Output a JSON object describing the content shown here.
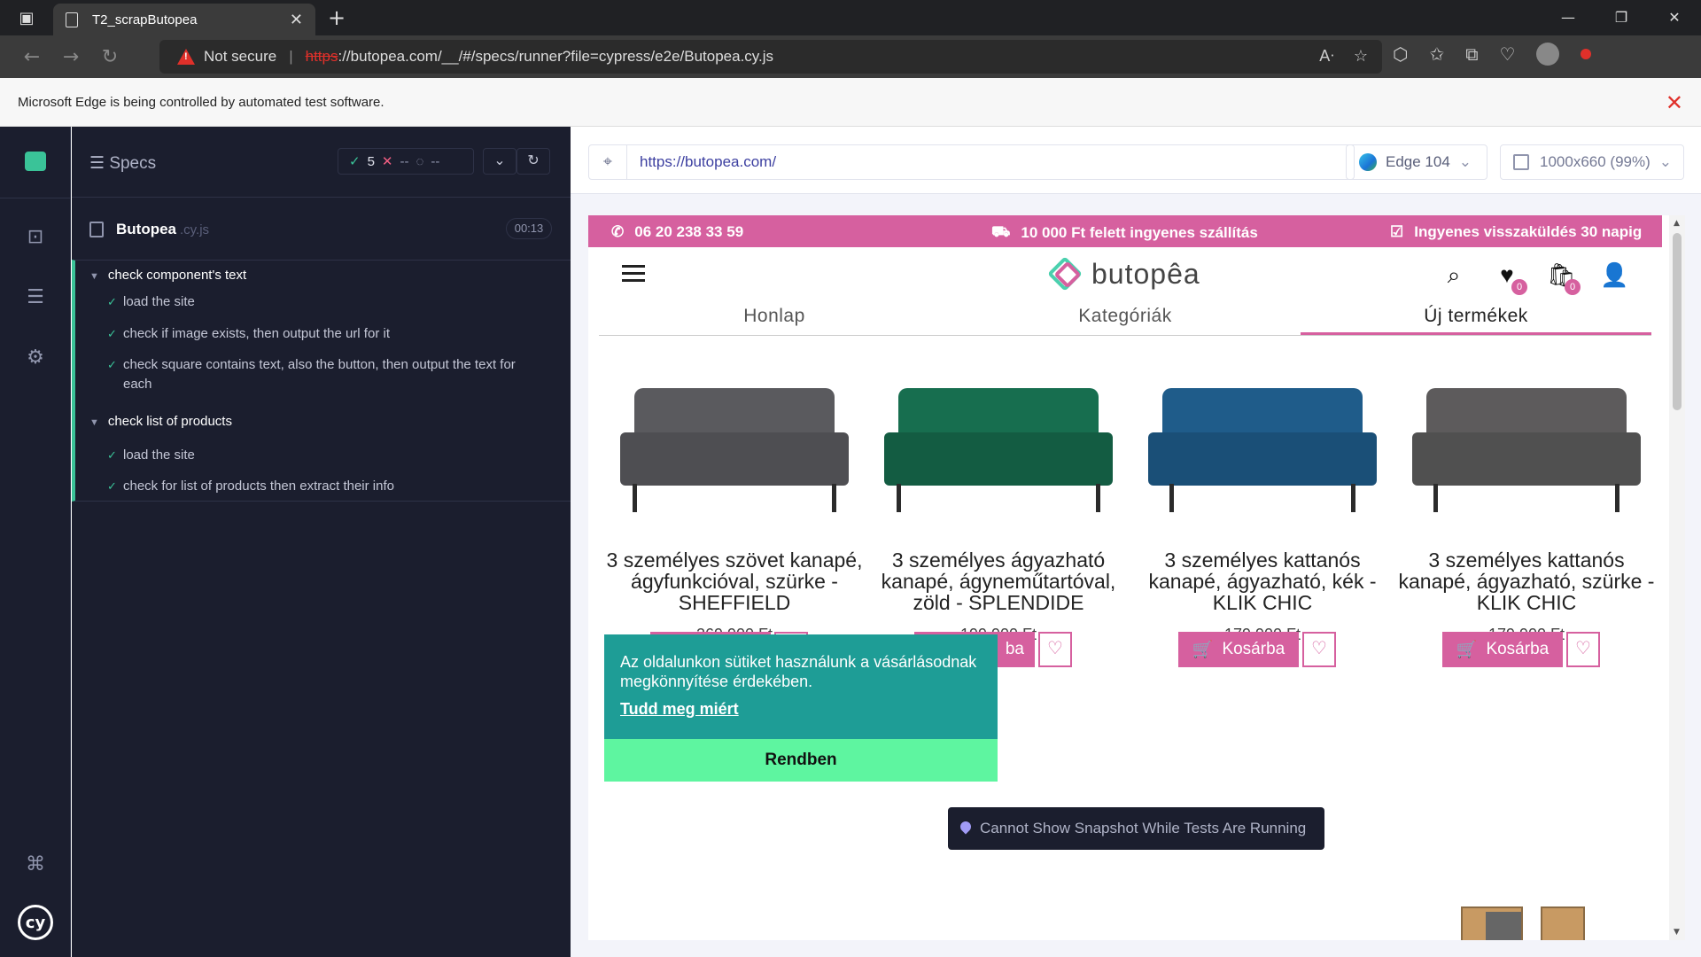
{
  "browser": {
    "tab_title": "T2_scrapButopea",
    "not_secure": "Not secure",
    "url_scheme": "https",
    "url_rest": "://butopea.com/__/#/specs/runner?file=cypress/e2e/Butopea.cy.js",
    "automation_notice": "Microsoft Edge is being controlled by automated test software."
  },
  "cypress": {
    "specs_label": "Specs",
    "passed_count": "5",
    "failed_count": "--",
    "pending_count": "--",
    "spec_name": "Butopea",
    "spec_ext": ".cy.js",
    "duration": "00:13",
    "suites": [
      {
        "title": "check component's text",
        "tests": [
          "load the site",
          "check if image exists, then output the url for it",
          "check square contains text, also the button, then output the text for each"
        ]
      },
      {
        "title": "check list of products",
        "tests": [
          "load the site",
          "check for list of products then extract their info"
        ]
      }
    ],
    "aut_url": "https://butopea.com/",
    "browser_label": "Edge 104",
    "viewport_label": "1000x660 (99%)",
    "snapshot_message": "Cannot Show Snapshot While Tests Are Running"
  },
  "site": {
    "colors": {
      "accent": "#d6609f",
      "teal": "#1e9d96",
      "green": "#5ef5a0"
    },
    "phone": "06 20 238 33 59",
    "shipping": "10 000 Ft felett ingyenes szállítás",
    "returns": "Ingyenes visszaküldés 30 napig",
    "brand": "butopêa",
    "wishlist_count": "0",
    "cart_count": "0",
    "nav": [
      "Honlap",
      "Kategóriák",
      "Új termékek"
    ],
    "products": [
      {
        "title": "3 személyes szövet kanapé, ágyfunkcióval, szürke - SHEFFIELD",
        "price": "269.900 Ft"
      },
      {
        "title": "3 személyes ágyazható kanapé, ágyneműtartóval, zöld - SPLENDIDE",
        "price": "199.900 Ft"
      },
      {
        "title": "3 személyes kattanós kanapé, ágyazható, kék - KLIK CHIC",
        "price": "179.900 Ft"
      },
      {
        "title": "3 személyes kattanós kanapé, ágyazható, szürke - KLIK CHIC",
        "price": "179.900 Ft"
      }
    ],
    "add_to_cart": "Kosárba",
    "partial_button_text": "ba",
    "cookie": {
      "message": "Az oldalunkon sütiket használunk a vásárlásodnak megkönnyítése érdekében.",
      "learn_more": "Tudd meg miért",
      "accept": "Rendben"
    }
  }
}
